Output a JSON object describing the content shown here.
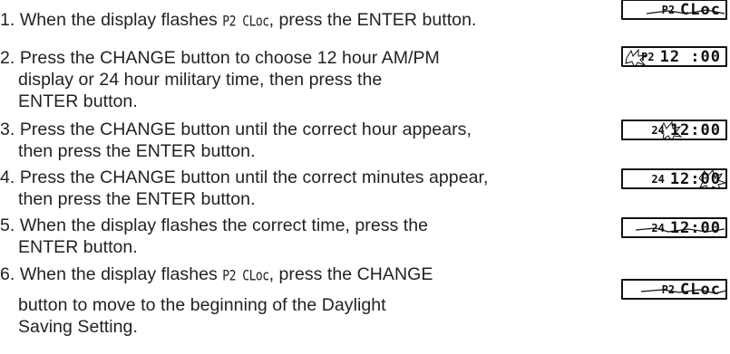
{
  "steps": [
    {
      "lines": [
        "1. When the display flashes ",
        ", press the ENTER button."
      ],
      "inline_code": "P2 CLoc"
    },
    {
      "lines": [
        "2. Press the CHANGE button to choose 12 hour AM/PM",
        "display or 24 hour military time, then press the",
        "ENTER button."
      ]
    },
    {
      "lines": [
        "3. Press the CHANGE button until the correct hour appears,",
        "then press the ENTER button."
      ]
    },
    {
      "lines": [
        "4. Press the CHANGE button until the correct minutes appear,",
        "then press the ENTER button."
      ]
    },
    {
      "lines": [
        "5. When the display flashes the correct time, press the",
        "ENTER button."
      ]
    },
    {
      "lines": [
        "6. When the display flashes ",
        ", press the CHANGE",
        "button to move to the beginning of the Daylight",
        "Saving Setting."
      ],
      "inline_code": "P2 CLoc"
    }
  ],
  "displays": [
    {
      "prefix": "P2",
      "value": "CLoc",
      "flash": "all"
    },
    {
      "prefix": "P2",
      "value": "12 :00",
      "flash": "prefix"
    },
    {
      "prefix": "24",
      "value": "12:00",
      "flash": "hour"
    },
    {
      "prefix": "24",
      "value": "12:00",
      "flash": "minutes"
    },
    {
      "prefix": "24",
      "value": "12:00",
      "flash": "all"
    },
    {
      "prefix": "P2",
      "value": "CLoc",
      "flash": "all"
    }
  ]
}
